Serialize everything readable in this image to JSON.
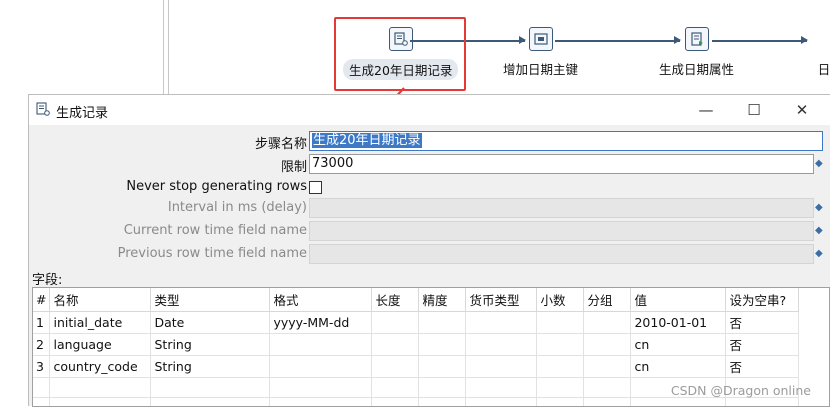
{
  "canvas": {
    "steps": [
      {
        "label": "生成20年日期记录",
        "icon": "generate-rows-icon"
      },
      {
        "label": "增加日期主键",
        "icon": "add-sequence-icon"
      },
      {
        "label": "生成日期属性",
        "icon": "calculator-icon"
      },
      {
        "label": "日",
        "icon": "step-icon"
      }
    ],
    "highlight_color": "#e53935"
  },
  "dialog": {
    "title": "生成记录",
    "minimize": "—",
    "maximize": "☐",
    "close": "✕",
    "step_name_label": "步骤名称",
    "step_name_value": "生成20年日期记录",
    "limit_label": "限制",
    "limit_value": "73000",
    "never_stop_label": "Never stop generating rows",
    "never_stop_checked": false,
    "interval_label": "Interval in ms (delay)",
    "current_row_label": "Current row time field name",
    "previous_row_label": "Previous row time field name",
    "fields_label": "字段:",
    "columns": [
      "#",
      "名称",
      "类型",
      "格式",
      "长度",
      "精度",
      "货币类型",
      "小数",
      "分组",
      "值",
      "设为空串?"
    ],
    "rows": [
      [
        "1",
        "initial_date",
        "Date",
        "yyyy-MM-dd",
        "",
        "",
        "",
        "",
        "",
        "2010-01-01",
        "否"
      ],
      [
        "2",
        "language",
        "String",
        "",
        "",
        "",
        "",
        "",
        "",
        "cn",
        "否"
      ],
      [
        "3",
        "country_code",
        "String",
        "",
        "",
        "",
        "",
        "",
        "",
        "cn",
        "否"
      ]
    ]
  },
  "watermark": "CSDN @Dragon online"
}
